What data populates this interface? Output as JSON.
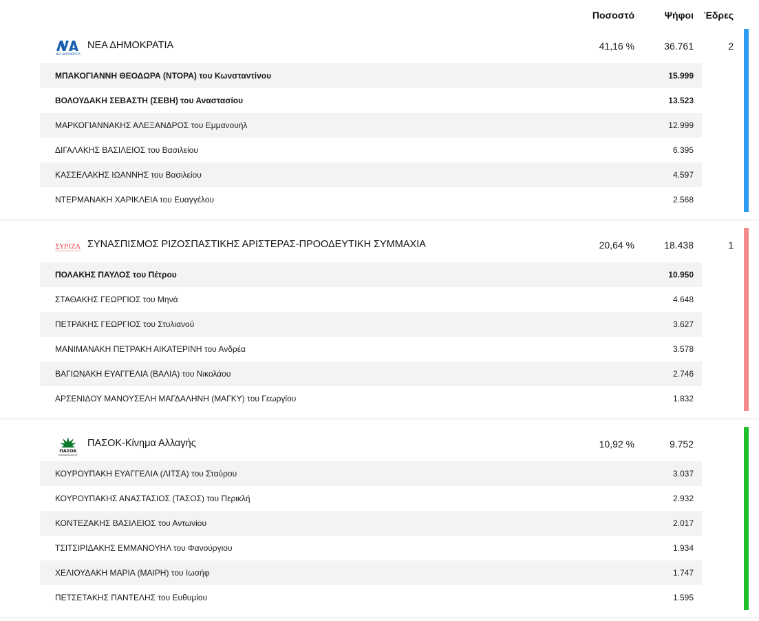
{
  "header": {
    "pct": "Ποσοστό",
    "votes": "Ψήφοι",
    "seats": "Έδρες"
  },
  "parties": [
    {
      "name": "ΝΕΑ ΔΗΜΟΚΡΑΤΙΑ",
      "logo_text": "ΝΔ",
      "logo_sub": "ΝΕΑ ΔΗΜΟΚΡΑΤΙΑ",
      "pct": "41,16 %",
      "votes": "36.761",
      "seats": "2",
      "color": "#2d9bf0",
      "candidates": [
        {
          "name": "ΜΠΑΚΟΓΙΑΝΝΗ ΘΕΟΔΩΡΑ (ΝΤΟΡΑ) του Κωνσταντίνου",
          "votes": "15.999",
          "elected": true
        },
        {
          "name": "ΒΟΛΟΥΔΑΚΗ ΣΕΒΑΣΤΗ (ΣΕΒΗ) του Αναστασίου",
          "votes": "13.523",
          "elected": true
        },
        {
          "name": "ΜΑΡΚΟΓΙΑΝΝΑΚΗΣ ΑΛΕΞΑΝΔΡΟΣ του Εμμανουήλ",
          "votes": "12.999",
          "elected": false
        },
        {
          "name": "ΔΙΓΑΛΑΚΗΣ ΒΑΣΙΛΕΙΟΣ του Βασιλείου",
          "votes": "6.395",
          "elected": false
        },
        {
          "name": "ΚΑΣΣΕΛΑΚΗΣ ΙΩΑΝΝΗΣ του Βασιλείου",
          "votes": "4.597",
          "elected": false
        },
        {
          "name": "ΝΤΕΡΜΑΝΑΚΗ ΧΑΡΙΚΛΕΙΑ του Ευαγγέλου",
          "votes": "2.568",
          "elected": false
        }
      ]
    },
    {
      "name": "ΣΥΝΑΣΠΙΣΜΟΣ ΡΙΖΟΣΠΑΣΤΙΚΗΣ ΑΡΙΣΤΕΡΑΣ-ΠΡΟΟΔΕΥΤΙΚΗ ΣΥΜΜΑΧΙΑ",
      "logo_text": "ΣΥΡΙΖΑ",
      "logo_sub": "",
      "pct": "20,64 %",
      "votes": "18.438",
      "seats": "1",
      "color": "#f58a8a",
      "candidates": [
        {
          "name": "ΠΟΛΑΚΗΣ ΠΑΥΛΟΣ του Πέτρου",
          "votes": "10.950",
          "elected": true
        },
        {
          "name": "ΣΤΑΘΑΚΗΣ ΓΕΩΡΓΙΟΣ του Μηνά",
          "votes": "4.648",
          "elected": false
        },
        {
          "name": "ΠΕΤΡΑΚΗΣ ΓΕΩΡΓΙΟΣ του Στυλιανού",
          "votes": "3.627",
          "elected": false
        },
        {
          "name": "ΜΑΝΙΜΑΝΑΚΗ ΠΕΤΡΑΚΗ ΑΙΚΑΤΕΡΙΝΗ του Ανδρέα",
          "votes": "3.578",
          "elected": false
        },
        {
          "name": "ΒΑΓΙΩΝΑΚΗ ΕΥΑΓΓΕΛΙΑ (ΒΑΛΙΑ) του Νικολάου",
          "votes": "2.746",
          "elected": false
        },
        {
          "name": "ΑΡΣΕΝΙΔΟΥ ΜΑΝΟΥΣΕΛΗ ΜΑΓΔΑΛΗΝΗ (ΜΑΓΚΥ) του Γεωργίου",
          "votes": "1.832",
          "elected": false
        }
      ]
    },
    {
      "name": "ΠΑΣΟΚ-Κίνημα Αλλαγής",
      "logo_text": "ΠΑΣΟΚ",
      "logo_sub": "Κίνημα Αλλαγής",
      "pct": "10,92 %",
      "votes": "9.752",
      "seats": "",
      "color": "#1fc02a",
      "candidates": [
        {
          "name": "ΚΟΥΡΟΥΠΑΚΗ ΕΥΑΓΓΕΛΙΑ (ΛΙΤΣΑ) του Σταύρου",
          "votes": "3.037",
          "elected": false
        },
        {
          "name": "ΚΟΥΡΟΥΠΑΚΗΣ ΑΝΑΣΤΑΣΙΟΣ (ΤΑΣΟΣ) του Περικλή",
          "votes": "2.932",
          "elected": false
        },
        {
          "name": "ΚΟΝΤΕΖΑΚΗΣ ΒΑΣΙΛΕΙΟΣ του Αντωνίου",
          "votes": "2.017",
          "elected": false
        },
        {
          "name": "ΤΣΙΤΣΙΡΙΔΑΚΗΣ ΕΜΜΑΝΟΥΗΛ του Φανούργιου",
          "votes": "1.934",
          "elected": false
        },
        {
          "name": "ΧΕΛΙΟΥΔΑΚΗ ΜΑΡΙΑ (ΜΑΙΡΗ) του Ιωσήφ",
          "votes": "1.747",
          "elected": false
        },
        {
          "name": "ΠΕΤΣΕΤΑΚΗΣ ΠΑΝΤΕΛΗΣ του Ευθυμίου",
          "votes": "1.595",
          "elected": false
        }
      ]
    }
  ]
}
